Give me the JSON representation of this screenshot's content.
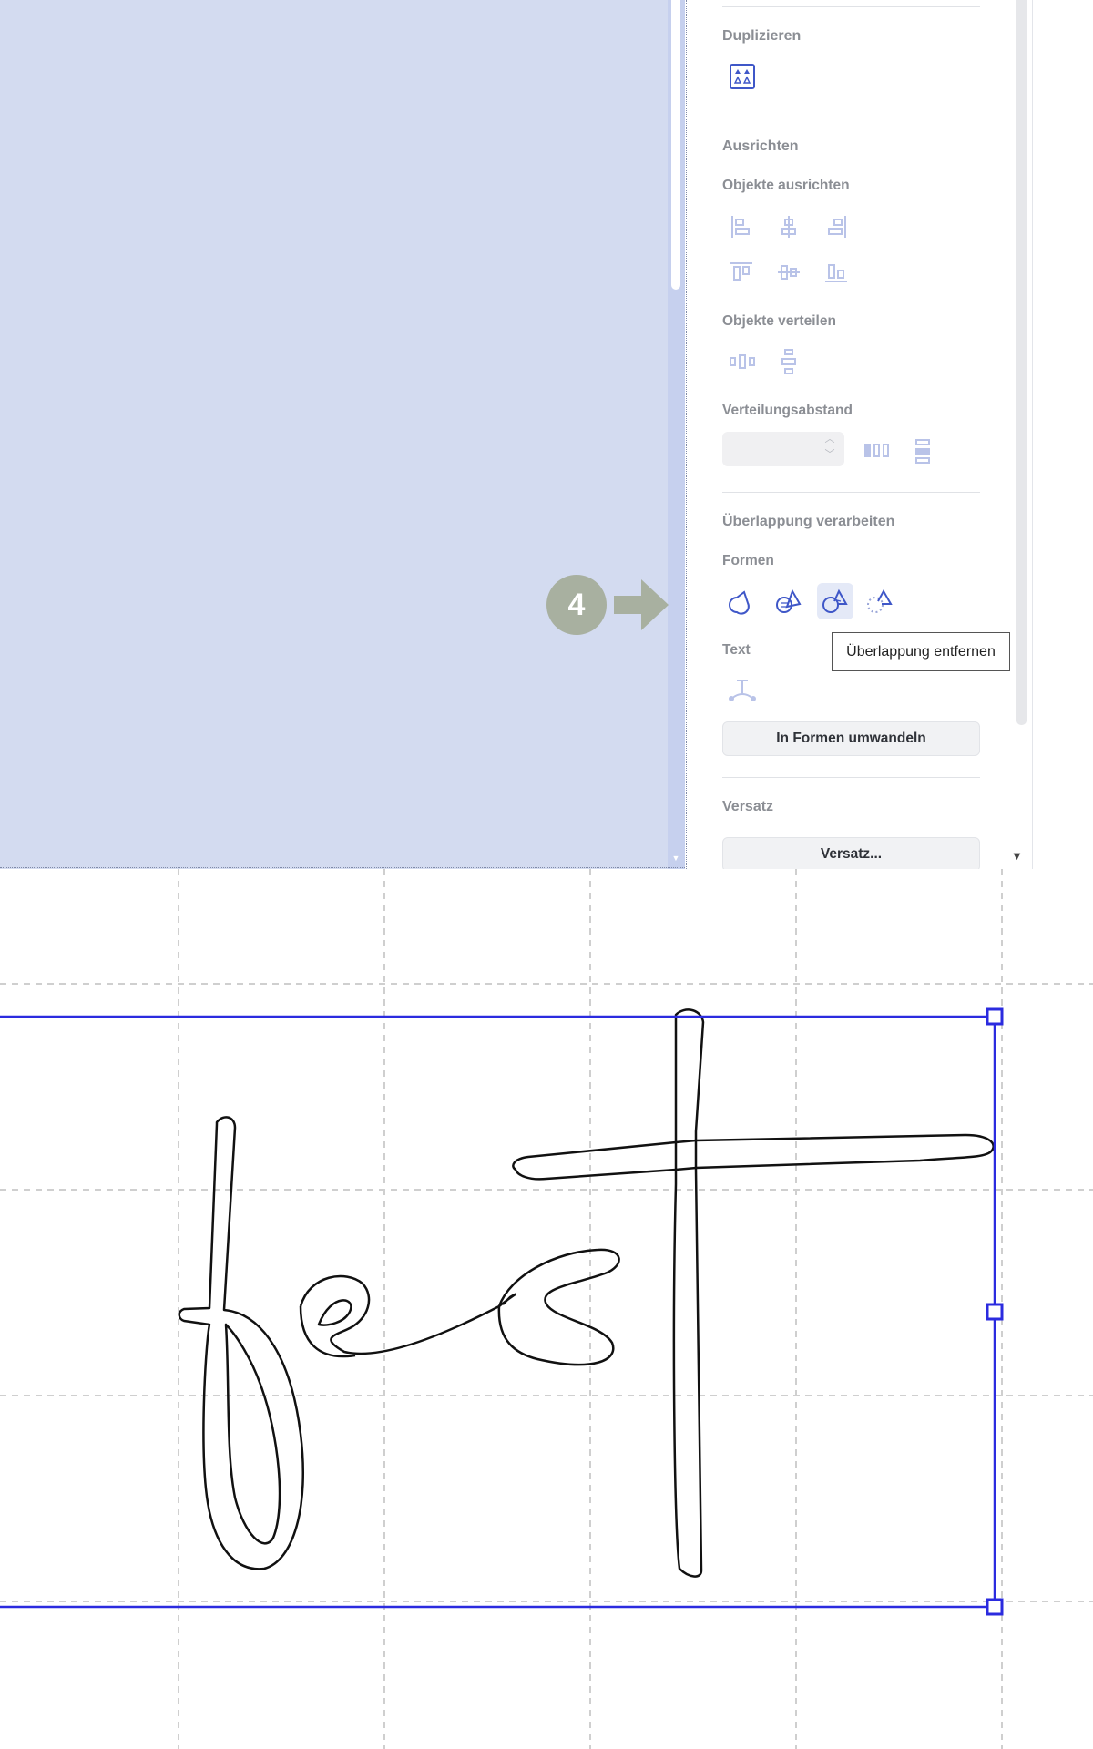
{
  "panel": {
    "sections": {
      "duplicate": {
        "title": "Duplizieren"
      },
      "align": {
        "title": "Ausrichten",
        "align_objects": "Objekte ausrichten",
        "distribute_objects": "Objekte verteilen",
        "spacing_label": "Verteilungsabstand",
        "spacing_value": ""
      },
      "overlap": {
        "title": "Überlappung verarbeiten",
        "shapes_label": "Formen",
        "text_label": "Text",
        "convert_button": "In Formen umwandeln"
      },
      "offset": {
        "title": "Versatz",
        "button": "Versatz..."
      }
    },
    "tooltip": "Überlappung entfernen"
  },
  "annotation": {
    "step_number": "4"
  },
  "colors": {
    "accent": "#3f57c8",
    "selection": "#2b2bdf",
    "canvas_blue": "#d3dbf0",
    "step_badge": "#a8b0a0"
  },
  "icons": {
    "duplicate": "duplicate-icon",
    "align": [
      "align-left-icon",
      "align-center-horizontal-icon",
      "align-right-icon",
      "align-top-icon",
      "align-middle-vertical-icon",
      "align-bottom-icon"
    ],
    "distribute": [
      "distribute-horizontal-icon",
      "distribute-vertical-icon"
    ],
    "overlap": [
      "weld-icon",
      "attach-icon",
      "remove-overlap-icon",
      "subtract-icon"
    ],
    "text": "text-on-path-icon"
  }
}
